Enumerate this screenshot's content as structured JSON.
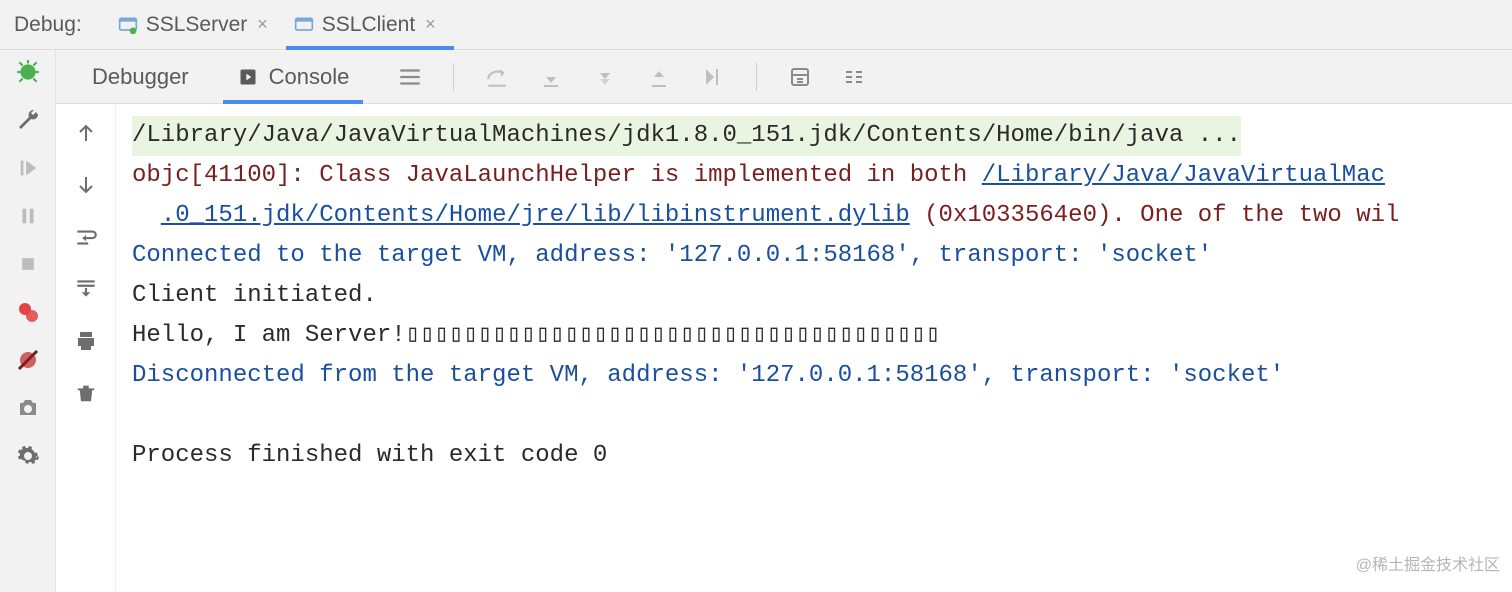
{
  "top": {
    "debug_label": "Debug:",
    "tabs": [
      {
        "label": "SSLServer",
        "active": false
      },
      {
        "label": "SSLClient",
        "active": true
      }
    ]
  },
  "inner": {
    "tabs": [
      {
        "label": "Debugger",
        "active": false
      },
      {
        "label": "Console",
        "active": true
      }
    ]
  },
  "left_icons": [
    "bug-icon",
    "wrench-icon",
    "resume-icon",
    "pause-icon",
    "stop-icon",
    "breakpoints-icon",
    "mute-breakpoints-icon",
    "camera-icon",
    "settings-icon"
  ],
  "console_gutter_icons": [
    "up-arrow-icon",
    "down-arrow-icon",
    "soft-wrap-icon",
    "scroll-to-end-icon",
    "print-icon",
    "trash-icon"
  ],
  "console": {
    "cmd_line": "/Library/Java/JavaVirtualMachines/jdk1.8.0_151.jdk/Contents/Home/bin/java ...",
    "objc_prefix": "objc[41100]: Class JavaLaunchHelper is implemented in both ",
    "objc_link1": "/Library/Java/JavaVirtualMac",
    "objc_link2": ".0_151.jdk/Contents/Home/jre/lib/libinstrument.dylib",
    "objc_tail": " (0x1033564e0). One of the two wil",
    "vm_connect": "Connected to the target VM, address: '127.0.0.1:58168', transport: 'socket'",
    "client_init": "Client initiated.",
    "hello_line": "Hello, I am Server!▯▯▯▯▯▯▯▯▯▯▯▯▯▯▯▯▯▯▯▯▯▯▯▯▯▯▯▯▯▯▯▯▯▯▯▯▯",
    "vm_disconnect": "Disconnected from the target VM, address: '127.0.0.1:58168', transport: 'socket'",
    "exit_line": "Process finished with exit code 0"
  },
  "watermark": "@稀土掘金技术社区"
}
